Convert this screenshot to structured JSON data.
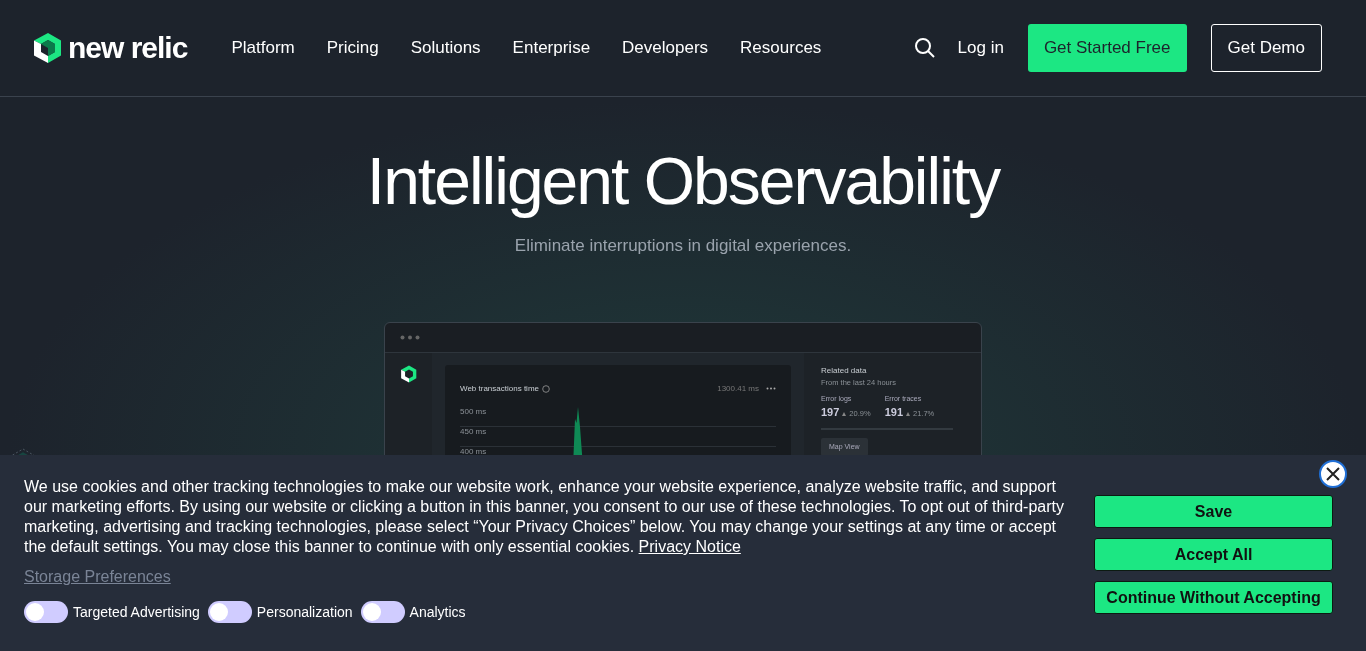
{
  "header": {
    "logo_text": "new relic",
    "nav": [
      "Platform",
      "Pricing",
      "Solutions",
      "Enterprise",
      "Developers",
      "Resources"
    ],
    "login": "Log in",
    "cta_primary": "Get Started Free",
    "cta_secondary": "Get Demo"
  },
  "hero": {
    "title": "Intelligent Observability",
    "subtitle": "Eliminate interruptions in digital experiences."
  },
  "dashboard": {
    "chart_title": "Web transactions time",
    "chart_value": "1300.41 ms",
    "y_labels": [
      "500 ms",
      "450 ms",
      "400 ms"
    ],
    "related_title": "Related data",
    "related_subtitle": "From the last 24 hours",
    "metrics": [
      {
        "label": "Error logs",
        "value": "197",
        "change": "20.9%"
      },
      {
        "label": "Error traces",
        "value": "191",
        "change": "21.7%"
      }
    ],
    "map_button": "Map View"
  },
  "cookie_banner": {
    "text": "We use cookies and other tracking technologies to make our website work, enhance your website experience, analyze website traffic, and support our marketing efforts. By using our website or clicking a button in this banner, you consent to our use of these technologies. To opt out of third-party marketing, advertising and tracking technologies, please select “Your Privacy Choices” below. You may change your settings at any time or accept the default settings. You may close this banner to continue with only essential cookies.",
    "privacy_link": "Privacy Notice",
    "storage_link": "Storage Preferences",
    "toggles": [
      {
        "label": "Targeted Advertising",
        "on": false
      },
      {
        "label": "Personalization",
        "on": false
      },
      {
        "label": "Analytics",
        "on": false
      }
    ],
    "buttons": [
      "Save",
      "Accept All",
      "Continue Without Accepting"
    ]
  }
}
